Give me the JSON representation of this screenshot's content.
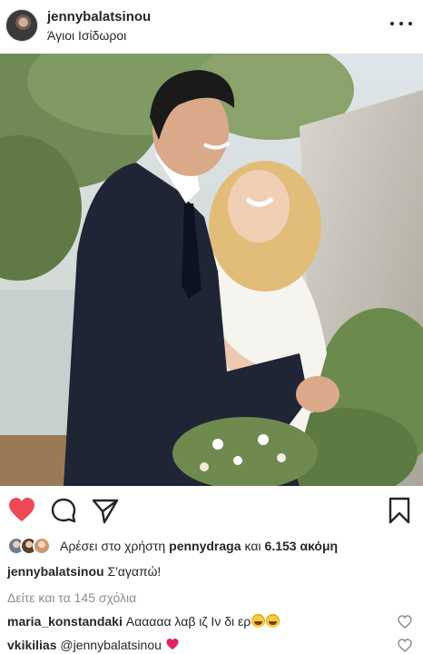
{
  "post": {
    "username": "jennybalatsinou",
    "location": "Άγιοι Ισίδωροι"
  },
  "actions": {
    "like_icon": "heart-filled-icon",
    "comment_icon": "comment-icon",
    "share_icon": "paper-plane-icon",
    "save_icon": "bookmark-icon",
    "like_color": "#ed4956"
  },
  "likes": {
    "prefix": "Αρέσει στο χρήστη",
    "user": "pennydraga",
    "connector": "και",
    "count": "6.153 ακόμη"
  },
  "caption": {
    "username": "jennybalatsinou",
    "text": "Σ'αγαπώ!"
  },
  "view_all_comments": "Δείτε και τα 145 σχόλια",
  "comments": [
    {
      "username": "maria_konstandaki",
      "text": "Αααααα λαβ ιζ Ιν δι ερ"
    },
    {
      "username": "vkikilias",
      "text": "@jennybalatsinou"
    }
  ]
}
